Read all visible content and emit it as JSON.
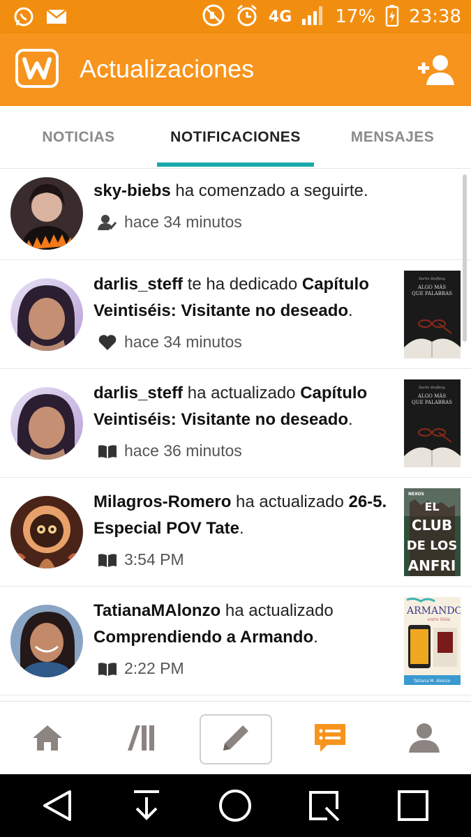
{
  "status_bar": {
    "battery": "17%",
    "network": "4G",
    "time": "23:38",
    "icons": [
      "whatsapp-icon",
      "mail-icon",
      "mute-icon",
      "alarm-icon",
      "signal-icon",
      "battery-charging-icon"
    ]
  },
  "app_bar": {
    "title": "Actualizaciones",
    "logo_letter": "W",
    "colors": {
      "bar": "#f7941d",
      "status": "#f28e0f",
      "accent": "#19a9a9"
    }
  },
  "tabs": [
    {
      "label": "NOTICIAS",
      "active": false
    },
    {
      "label": "NOTIFICACIONES",
      "active": true
    },
    {
      "label": "MENSAJES",
      "active": false
    }
  ],
  "notifications": [
    {
      "user": "sky-biebs",
      "action": " ha comenzado a seguirte.",
      "target": "",
      "time": "hace 34 minutos",
      "type_icon": "follow-icon"
    },
    {
      "user": "darlis_steff",
      "action": " te ha dedicado ",
      "target": "Capítulo Veintiséis: Visitante no deseado",
      "time": "hace 34 minutos",
      "type_icon": "heart-icon",
      "cover": {
        "author": "Darlis Steffany",
        "title_line1": "ALGO MÁS",
        "title_line2": "QUE PALABRAS"
      }
    },
    {
      "user": "darlis_steff",
      "action": " ha actualizado ",
      "target": "Capítulo Veintiséis: Visitante no deseado",
      "time": "hace 36 minutos",
      "type_icon": "book-icon",
      "cover": {
        "author": "Darlis Steffany",
        "title_line1": "ALGO MÁS",
        "title_line2": "QUE PALABRAS"
      }
    },
    {
      "user": "Milagros-Romero",
      "action": " ha actualizado ",
      "target": "26-5. Especial POV Tate",
      "time": "3:54 PM",
      "type_icon": "book-icon",
      "cover": {
        "tag": "NEXOS",
        "title_line1": "EL",
        "title_line2": "CLUB",
        "title_line3": "DE LOS",
        "title_line4": "ANFRI"
      }
    },
    {
      "user": "TatianaMAlonzo",
      "action": " ha actualizado ",
      "target": "Comprendiendo a Armando",
      "time": "2:22 PM",
      "type_icon": "book-icon",
      "cover": {
        "title_line1": "ARMANDO",
        "subtitle": "entre hilos",
        "author": "Tatiana M. Alonzo"
      }
    }
  ],
  "bottom_nav": [
    "home-icon",
    "library-icon",
    "write-icon",
    "notifications-icon",
    "profile-icon"
  ]
}
